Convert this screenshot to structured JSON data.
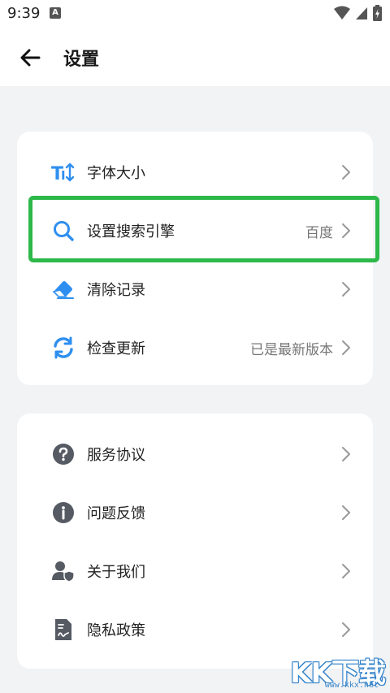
{
  "status_bar": {
    "time": "9:39",
    "notification_badge": "A"
  },
  "header": {
    "title": "设置"
  },
  "groups": [
    {
      "items": [
        {
          "label": "字体大小",
          "icon": "font-size-icon",
          "value": ""
        },
        {
          "label": "设置搜索引擎",
          "icon": "search-icon",
          "value": "百度"
        },
        {
          "label": "清除记录",
          "icon": "eraser-icon",
          "value": ""
        },
        {
          "label": "检查更新",
          "icon": "refresh-icon",
          "value": "已是最新版本"
        }
      ]
    },
    {
      "items": [
        {
          "label": "服务协议",
          "icon": "question-circle-icon",
          "value": ""
        },
        {
          "label": "问题反馈",
          "icon": "info-circle-icon",
          "value": ""
        },
        {
          "label": "关于我们",
          "icon": "user-shield-icon",
          "value": ""
        },
        {
          "label": "隐私政策",
          "icon": "document-icon",
          "value": ""
        }
      ]
    }
  ],
  "watermark": {
    "brand": "KK下载",
    "url": "www.kkx.net"
  },
  "colors": {
    "accent": "#2f8ff0",
    "highlight": "#2db84a",
    "icon_gray": "#555a63",
    "background": "#f2f3f5"
  }
}
